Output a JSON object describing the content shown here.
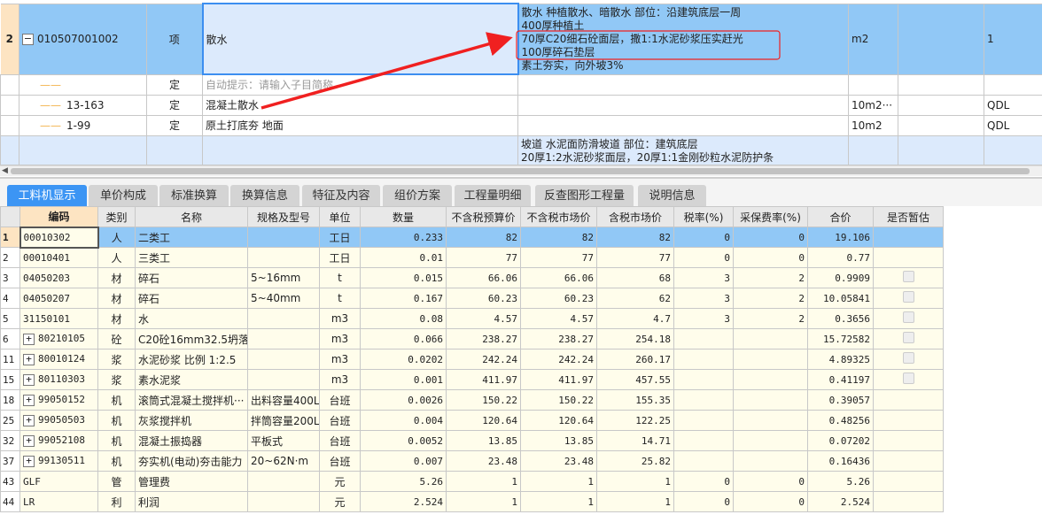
{
  "top_grid": {
    "rows": [
      {
        "num": "2",
        "code": "010507001002",
        "type": "项",
        "name": "散水",
        "more": "···",
        "desc": [
          "散水 种植散水、暗散水 部位：沿建筑底层一周",
          "400厚种植土",
          "70厚C20细石砼面层，撒1:1水泥砂浆压实赶光",
          "100厚碎石垫层",
          "素土夯实，向外坡3%"
        ],
        "unit": "m2",
        "col8": "",
        "col9": "1"
      },
      {
        "num": "",
        "code": "",
        "type": "定",
        "name": "自动提示：请输入子目简称",
        "desc": [],
        "unit": "",
        "col8": "",
        "col9": ""
      },
      {
        "num": "",
        "code": "13-163",
        "type": "定",
        "name": "混凝土散水",
        "desc": [],
        "unit": "10m2···",
        "col8": "",
        "col9": "QDL"
      },
      {
        "num": "",
        "code": "1-99",
        "type": "定",
        "name": "原土打底夯 地面",
        "desc": [],
        "unit": "10m2",
        "col8": "",
        "col9": "QDL"
      },
      {
        "num": "",
        "code": "",
        "type": "",
        "name": "",
        "desc": [
          "坡道 水泥面防滑坡道 部位：建筑底层",
          "20厚1:2水泥砂浆面层，20厚1:1金刚砂粒水泥防护条"
        ],
        "unit": "",
        "col8": "",
        "col9": ""
      }
    ]
  },
  "tabs": [
    "工料机显示",
    "单价构成",
    "标准换算",
    "换算信息",
    "特征及内容",
    "组价方案",
    "工程量明细",
    "反查图形工程量",
    "说明信息"
  ],
  "active_tab": 0,
  "resource_table": {
    "headers": [
      "",
      "编码",
      "类别",
      "名称",
      "规格及型号",
      "单位",
      "数量",
      "不含税预算价",
      "不含税市场价",
      "含税市场价",
      "税率(%)",
      "采保费率(%)",
      "合价",
      "是否暂估"
    ],
    "rows": [
      {
        "num": "1",
        "expand": false,
        "code": "00010302",
        "type": "人",
        "name": "二类工",
        "spec": "",
        "unit": "工日",
        "qty": "0.233",
        "budget": "82",
        "market": "82",
        "market_tax": "82",
        "tax": "0",
        "fee": "0",
        "total": "19.106",
        "est": null
      },
      {
        "num": "2",
        "expand": false,
        "code": "00010401",
        "type": "人",
        "name": "三类工",
        "spec": "",
        "unit": "工日",
        "qty": "0.01",
        "budget": "77",
        "market": "77",
        "market_tax": "77",
        "tax": "0",
        "fee": "0",
        "total": "0.77",
        "est": null
      },
      {
        "num": "3",
        "expand": false,
        "code": "04050203",
        "type": "材",
        "name": "碎石",
        "spec": "5~16mm",
        "unit": "t",
        "qty": "0.015",
        "budget": "66.06",
        "market": "66.06",
        "market_tax": "68",
        "tax": "3",
        "fee": "2",
        "total": "0.9909",
        "est": false
      },
      {
        "num": "4",
        "expand": false,
        "code": "04050207",
        "type": "材",
        "name": "碎石",
        "spec": "5~40mm",
        "unit": "t",
        "qty": "0.167",
        "budget": "60.23",
        "market": "60.23",
        "market_tax": "62",
        "tax": "3",
        "fee": "2",
        "total": "10.05841",
        "est": false
      },
      {
        "num": "5",
        "expand": false,
        "code": "31150101",
        "type": "材",
        "name": "水",
        "spec": "",
        "unit": "m3",
        "qty": "0.08",
        "budget": "4.57",
        "market": "4.57",
        "market_tax": "4.7",
        "tax": "3",
        "fee": "2",
        "total": "0.3656",
        "est": false
      },
      {
        "num": "6",
        "expand": true,
        "code": "80210105",
        "type": "砼",
        "name": "C20砼16mm32.5坍落···",
        "spec": "",
        "unit": "m3",
        "qty": "0.066",
        "budget": "238.27",
        "market": "238.27",
        "market_tax": "254.18",
        "tax": "",
        "fee": "",
        "total": "15.72582",
        "est": false
      },
      {
        "num": "11",
        "expand": true,
        "code": "80010124",
        "type": "浆",
        "name": "水泥砂浆 比例 1:2.5",
        "spec": "",
        "unit": "m3",
        "qty": "0.0202",
        "budget": "242.24",
        "market": "242.24",
        "market_tax": "260.17",
        "tax": "",
        "fee": "",
        "total": "4.89325",
        "est": false
      },
      {
        "num": "15",
        "expand": true,
        "code": "80110303",
        "type": "浆",
        "name": "素水泥浆",
        "spec": "",
        "unit": "m3",
        "qty": "0.001",
        "budget": "411.97",
        "market": "411.97",
        "market_tax": "457.55",
        "tax": "",
        "fee": "",
        "total": "0.41197",
        "est": false
      },
      {
        "num": "18",
        "expand": true,
        "code": "99050152",
        "type": "机",
        "name": "滚筒式混凝土搅拌机···",
        "spec": "出料容量400L",
        "unit": "台班",
        "qty": "0.0026",
        "budget": "150.22",
        "market": "150.22",
        "market_tax": "155.35",
        "tax": "",
        "fee": "",
        "total": "0.39057",
        "est": null
      },
      {
        "num": "25",
        "expand": true,
        "code": "99050503",
        "type": "机",
        "name": "灰浆搅拌机",
        "spec": "拌筒容量200L",
        "unit": "台班",
        "qty": "0.004",
        "budget": "120.64",
        "market": "120.64",
        "market_tax": "122.25",
        "tax": "",
        "fee": "",
        "total": "0.48256",
        "est": null
      },
      {
        "num": "32",
        "expand": true,
        "code": "99052108",
        "type": "机",
        "name": "混凝土振捣器",
        "spec": "平板式",
        "unit": "台班",
        "qty": "0.0052",
        "budget": "13.85",
        "market": "13.85",
        "market_tax": "14.71",
        "tax": "",
        "fee": "",
        "total": "0.07202",
        "est": null
      },
      {
        "num": "37",
        "expand": true,
        "code": "99130511",
        "type": "机",
        "name": "夯实机(电动)夯击能力",
        "spec": "20~62N·m",
        "unit": "台班",
        "qty": "0.007",
        "budget": "23.48",
        "market": "23.48",
        "market_tax": "25.82",
        "tax": "",
        "fee": "",
        "total": "0.16436",
        "est": null
      },
      {
        "num": "43",
        "expand": false,
        "code": "GLF",
        "type": "管",
        "name": "管理费",
        "spec": "",
        "unit": "元",
        "qty": "5.26",
        "budget": "1",
        "market": "1",
        "market_tax": "1",
        "tax": "0",
        "fee": "0",
        "total": "5.26",
        "est": null
      },
      {
        "num": "44",
        "expand": false,
        "code": "LR",
        "type": "利",
        "name": "利润",
        "spec": "",
        "unit": "元",
        "qty": "2.524",
        "budget": "1",
        "market": "1",
        "market_tax": "1",
        "tax": "0",
        "fee": "0",
        "total": "2.524",
        "est": null
      }
    ]
  },
  "colors": {
    "selection": "#91c8f6",
    "accent": "#3c95f4",
    "annotation": "#f02020",
    "row_bg": "#fffdeb"
  }
}
